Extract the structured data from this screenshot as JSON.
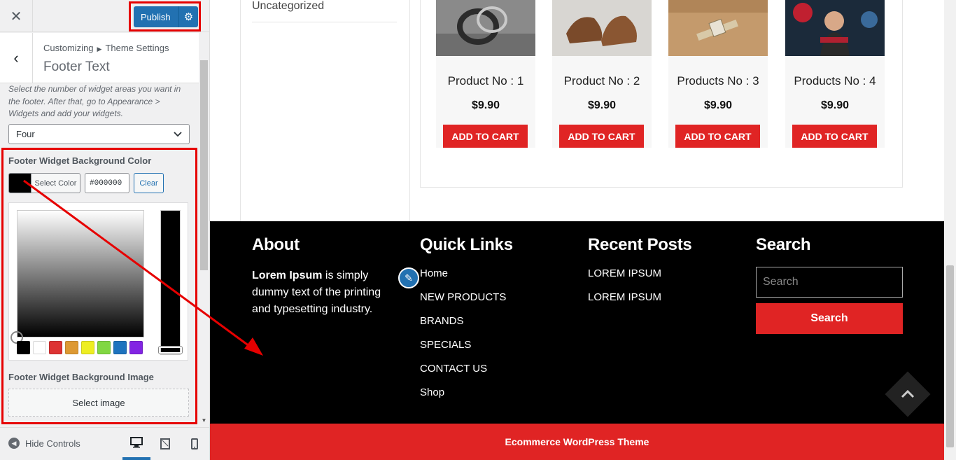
{
  "topbar": {
    "close_icon": "close-icon",
    "publish_label": "Publish",
    "publish_settings_icon": "gear-icon"
  },
  "header": {
    "breadcrumb_root": "Customizing",
    "breadcrumb_section": "Theme Settings",
    "title": "Footer Text"
  },
  "widgets_description": "Select the number of widget areas you want in the footer. After that, go to Appearance > Widgets and add your widgets.",
  "widget_areas_select": {
    "value": "Four"
  },
  "bg_color_control": {
    "title": "Footer Widget Background Color",
    "select_label": "Select Color",
    "hex_value": "#000000",
    "clear_label": "Clear",
    "current_color": "#000000",
    "palette": [
      "#000000",
      "#ffffff",
      "#dd3333",
      "#dd9933",
      "#eeee22",
      "#81d742",
      "#1e73be",
      "#8224e3"
    ]
  },
  "bg_image_control": {
    "title": "Footer Widget Background Image",
    "button_label": "Select image"
  },
  "bottom": {
    "hide_controls_label": "Hide Controls",
    "devices": [
      "desktop",
      "tablet",
      "mobile"
    ]
  },
  "preview": {
    "category_item": "Uncategorized",
    "products": [
      {
        "name": "Product No : 1",
        "price": "$9.90",
        "cart_label": "ADD TO CART",
        "image": "rings"
      },
      {
        "name": "Product No : 2",
        "price": "$9.90",
        "cart_label": "ADD TO CART",
        "image": "shoes"
      },
      {
        "name": "Products No : 3",
        "price": "$9.90",
        "cart_label": "ADD TO CART",
        "image": "watch"
      },
      {
        "name": "Products No : 4",
        "price": "$9.90",
        "cart_label": "ADD TO CART",
        "image": "woman-portrait"
      }
    ],
    "footer": {
      "about": {
        "title": "About",
        "text_bold": "Lorem Ipsum",
        "text_rest": " is simply dummy text of the printing and typesetting industry."
      },
      "quick_links": {
        "title": "Quick Links",
        "items": [
          "Home",
          "NEW PRODUCTS",
          "BRANDS",
          "SPECIALS",
          "CONTACT US",
          "Shop"
        ]
      },
      "recent_posts": {
        "title": "Recent Posts",
        "items": [
          "LOREM IPSUM",
          "LOREM IPSUM"
        ]
      },
      "search": {
        "title": "Search",
        "placeholder": "Search",
        "button_label": "Search"
      }
    },
    "copyright": "Ecommerce WordPress Theme",
    "accent_color": "#e02424"
  },
  "annotation_color": "#e60000"
}
